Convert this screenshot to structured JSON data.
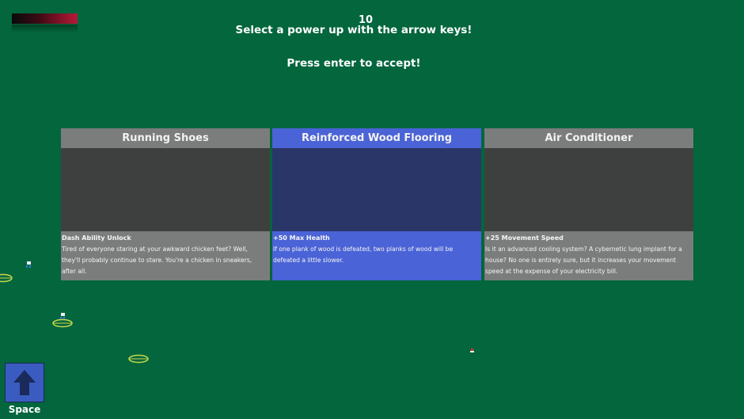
{
  "hud": {
    "health_fill": 1.0,
    "counter": "10"
  },
  "prompts": {
    "select": "Select a power up with the arrow keys!",
    "accept": "Press enter to accept!"
  },
  "cards": [
    {
      "title": "Running Shoes",
      "stat": "Dash Ability Unlock",
      "description": "Tired of everyone staring at your awkward chicken feet? Well, they'll probably continue to stare. You're a chicken in sneakers, after all.",
      "selected": false
    },
    {
      "title": "Reinforced Wood Flooring",
      "stat": "+50 Max Health",
      "description": "If one plank of wood is defeated, two planks of wood will be defeated a little slower.",
      "selected": true
    },
    {
      "title": "Air Conditioner",
      "stat": "+25 Movement Speed",
      "description": "Is it an advanced cooling system? A cybernetic lung implant for a house? No one is entirely sure, but it increases your movement speed at the expense of your electricity bill.",
      "selected": false
    }
  ],
  "controls": {
    "space_label": "Space",
    "space_icon": "up-arrow-icon"
  },
  "colors": {
    "background": "#03663d",
    "card": "#7a7d7b",
    "card_selected": "#4a63d6",
    "ring": "#c8d84a"
  }
}
